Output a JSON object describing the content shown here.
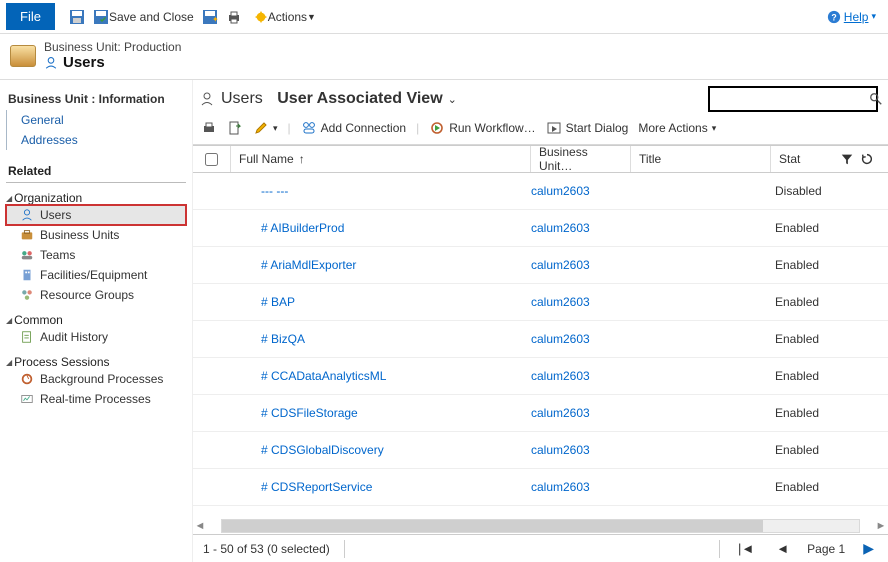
{
  "topbar": {
    "save_and_close": "Save and Close",
    "actions_label": "Actions",
    "help_label": "Help"
  },
  "context": {
    "line1": "Business Unit: Production",
    "line2": "Users"
  },
  "nav": {
    "info_header": "Business Unit : Information",
    "general": "General",
    "addresses": "Addresses",
    "related": "Related",
    "organization": "Organization",
    "org_items": [
      "Users",
      "Business Units",
      "Teams",
      "Facilities/Equipment",
      "Resource Groups"
    ],
    "common": "Common",
    "common_items": [
      "Audit History"
    ],
    "process": "Process Sessions",
    "process_items": [
      "Background Processes",
      "Real-time Processes"
    ]
  },
  "view": {
    "entity": "Users",
    "name": "User Associated View"
  },
  "toolbar2": {
    "add_connection": "Add Connection",
    "run_workflow": "Run Workflow…",
    "start_dialog": "Start Dialog",
    "more_actions": "More Actions"
  },
  "columns": {
    "full_name": "Full Name",
    "business_unit": "Business Unit…",
    "title": "Title",
    "status": "Stat"
  },
  "rows": [
    {
      "full_name": "--- ---",
      "bu": "calum2603",
      "status": "Disabled"
    },
    {
      "full_name": "# AIBuilderProd",
      "bu": "calum2603",
      "status": "Enabled"
    },
    {
      "full_name": "# AriaMdlExporter",
      "bu": "calum2603",
      "status": "Enabled"
    },
    {
      "full_name": "# BAP",
      "bu": "calum2603",
      "status": "Enabled"
    },
    {
      "full_name": "# BizQA",
      "bu": "calum2603",
      "status": "Enabled"
    },
    {
      "full_name": "# CCADataAnalyticsML",
      "bu": "calum2603",
      "status": "Enabled"
    },
    {
      "full_name": "# CDSFileStorage",
      "bu": "calum2603",
      "status": "Enabled"
    },
    {
      "full_name": "# CDSGlobalDiscovery",
      "bu": "calum2603",
      "status": "Enabled"
    },
    {
      "full_name": "# CDSReportService",
      "bu": "calum2603",
      "status": "Enabled"
    }
  ],
  "pager": {
    "range": "1 - 50 of 53 (0 selected)",
    "page": "Page 1"
  },
  "file_tab": "File"
}
